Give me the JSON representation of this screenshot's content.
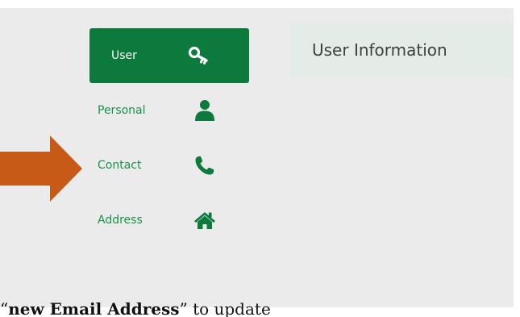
{
  "nav": {
    "items": [
      {
        "label": "User",
        "icon": "key-icon",
        "active": true
      },
      {
        "label": "Personal",
        "icon": "user-icon",
        "active": false
      },
      {
        "label": "Contact",
        "icon": "phone-icon",
        "active": false
      },
      {
        "label": "Address",
        "icon": "home-icon",
        "active": false
      }
    ]
  },
  "header": {
    "title": "User Information"
  },
  "caption": {
    "open_quote": "“",
    "bold": "new Email Address",
    "rest": "” to update"
  },
  "colors": {
    "brand_green": "#0d7a3d",
    "link_green": "#19934b",
    "arrow_orange": "#c85a17",
    "panel_bg": "#ebebeb",
    "header_bg": "#e3ece6"
  }
}
